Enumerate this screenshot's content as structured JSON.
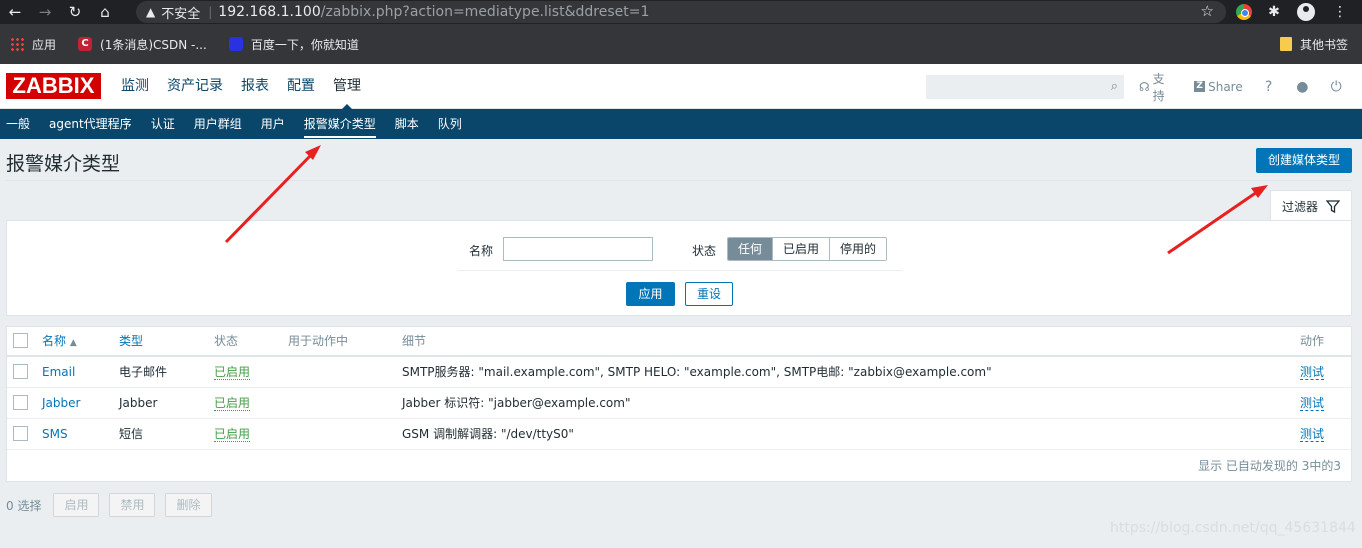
{
  "browser": {
    "insecure_label": "不安全",
    "url_host": "192.168.1.100",
    "url_path": "/zabbix.php?action=mediatype.list&ddreset=1",
    "bookmarks": [
      "应用",
      "(1条消息)CSDN -...",
      "百度一下，你就知道"
    ],
    "other_bookmarks": "其他书签"
  },
  "header": {
    "logo": "ZABBIX",
    "main_menu": [
      "监测",
      "资产记录",
      "报表",
      "配置",
      "管理"
    ],
    "support": "支持",
    "share": "Share",
    "help": "?"
  },
  "sub_menu": [
    "一般",
    "agent代理程序",
    "认证",
    "用户群组",
    "用户",
    "报警媒介类型",
    "脚本",
    "队列"
  ],
  "page": {
    "title": "报警媒介类型",
    "create_button": "创建媒体类型",
    "filter_tab": "过滤器"
  },
  "filter": {
    "name_label": "名称",
    "name_value": "",
    "status_label": "状态",
    "status_options": [
      "任何",
      "已启用",
      "停用的"
    ],
    "status_selected": "任何",
    "apply": "应用",
    "reset": "重设"
  },
  "table": {
    "headers": {
      "name": "名称",
      "sort_arrow": "▲",
      "type": "类型",
      "status": "状态",
      "used_in_actions": "用于动作中",
      "details": "细节",
      "action": "动作"
    },
    "rows": [
      {
        "name": "Email",
        "type": "电子邮件",
        "status": "已启用",
        "used": "",
        "details": "SMTP服务器: \"mail.example.com\", SMTP HELO: \"example.com\", SMTP电邮: \"zabbix@example.com\"",
        "action": "测试"
      },
      {
        "name": "Jabber",
        "type": "Jabber",
        "status": "已启用",
        "used": "",
        "details": "Jabber 标识符: \"jabber@example.com\"",
        "action": "测试"
      },
      {
        "name": "SMS",
        "type": "短信",
        "status": "已启用",
        "used": "",
        "details": "GSM 调制解调器: \"/dev/ttyS0\"",
        "action": "测试"
      }
    ],
    "footer": "显示 已自动发现的 3中的3"
  },
  "bulk": {
    "selected": "0 选择",
    "enable": "启用",
    "disable": "禁用",
    "delete": "删除"
  },
  "watermark": "https://blog.csdn.net/qq_45631844",
  "colors": {
    "brand_red": "#d40000",
    "nav_blue": "#0a466a",
    "primary": "#0275b8",
    "enabled_green": "#429e47",
    "annotation_arrow": "#e8201f"
  }
}
